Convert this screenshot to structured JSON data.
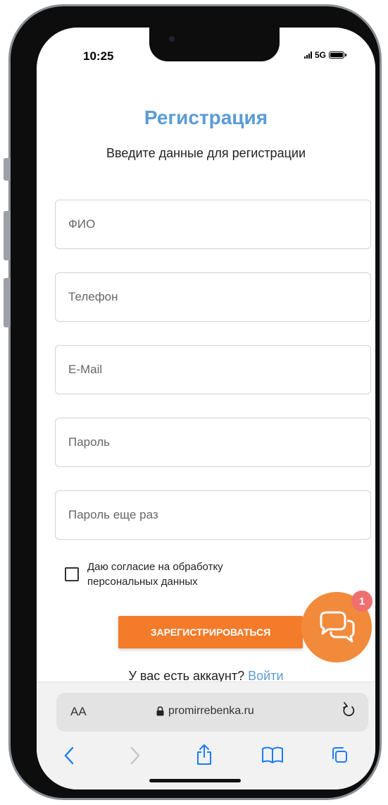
{
  "status_bar": {
    "time": "10:25",
    "network": "5G"
  },
  "registration": {
    "title": "Регистрация",
    "subtitle": "Введите данные для регистрации",
    "fields": [
      {
        "placeholder": "ФИО",
        "value": ""
      },
      {
        "placeholder": "Телефон",
        "value": ""
      },
      {
        "placeholder": "E-Mail",
        "value": ""
      },
      {
        "placeholder": "Пароль",
        "value": ""
      },
      {
        "placeholder": "Пароль еще раз",
        "value": ""
      }
    ],
    "consent_line1": "Даю согласие на обработку",
    "consent_line2": "персональных данных",
    "consent_checked": false,
    "register_label": "Зарегистрироваться",
    "account_prompt": "У вас есть аккаунт?",
    "login_label": "Войти"
  },
  "chat": {
    "badge_count": "1",
    "icon": "chat-bubbles-icon",
    "color": "#f28a3c"
  },
  "browser": {
    "text_size_label": "AA",
    "url": "promirrebenka.ru"
  },
  "colors": {
    "accent": "#5b9bd5",
    "button": "#f47b2a",
    "badge": "#f07070"
  }
}
